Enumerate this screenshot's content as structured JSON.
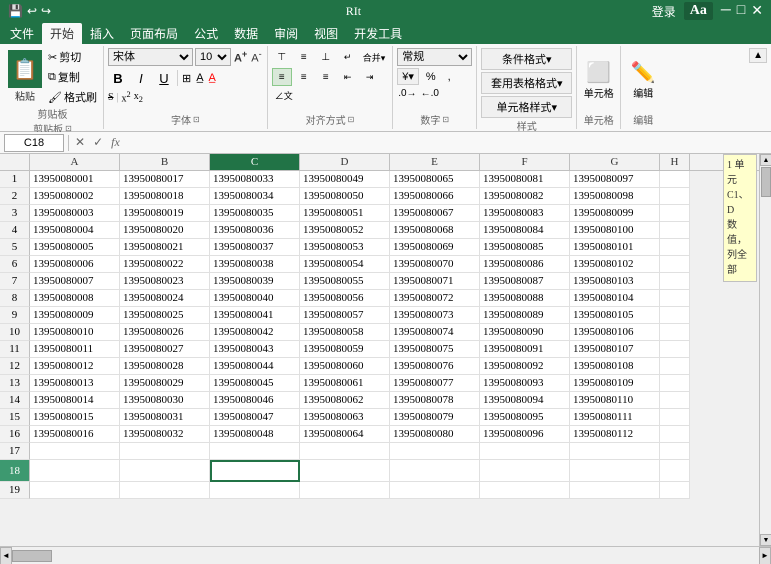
{
  "titlebar": {
    "title": "RIt",
    "login": "登录"
  },
  "ribbon": {
    "tabs": [
      "文件",
      "开始",
      "插入",
      "页面布局",
      "公式",
      "数据",
      "审阅",
      "视图",
      "开发工具"
    ],
    "active_tab": "开始",
    "aa_label": "Aa",
    "clipboard_label": "剪贴板",
    "font_label": "字体",
    "alignment_label": "对齐方式",
    "number_label": "数字",
    "styles_label": "样式",
    "cells_label": "单元格",
    "edit_label": "编辑",
    "font_name": "宋体",
    "font_size": "10",
    "paste_label": "粘贴",
    "cut_label": "剪切",
    "copy_label": "复制",
    "format_painter_label": "格式刷",
    "bold_label": "B",
    "italic_label": "I",
    "underline_label": "U",
    "strikethrough_label": "S",
    "font_grow_label": "A",
    "font_shrink_label": "A",
    "conditional_format_label": "条件格式▾",
    "format_table_label": "套用表格格式▾",
    "cell_styles_label": "单元格样式▾",
    "cells_btn_label": "单元格",
    "edit_btn_label": "编辑",
    "number_format": "常规",
    "percent_label": "%",
    "comma_label": ",",
    "increase_decimal": ".0",
    "decrease_decimal": ".00"
  },
  "formulabar": {
    "name_box": "C18",
    "cancel_label": "✕",
    "confirm_label": "✓",
    "fx_label": "fx",
    "formula_value": ""
  },
  "columns": [
    "A",
    "B",
    "C",
    "D",
    "E",
    "F",
    "G",
    "H"
  ],
  "rows": [
    {
      "row": 1,
      "cells": [
        "13950080001",
        "13950080017",
        "13950080033",
        "13950080049",
        "13950080065",
        "13950080081",
        "13950080097",
        ""
      ]
    },
    {
      "row": 2,
      "cells": [
        "13950080002",
        "13950080018",
        "13950080034",
        "13950080050",
        "13950080066",
        "13950080082",
        "13950080098",
        ""
      ]
    },
    {
      "row": 3,
      "cells": [
        "13950080003",
        "13950080019",
        "13950080035",
        "13950080051",
        "13950080067",
        "13950080083",
        "13950080099",
        ""
      ]
    },
    {
      "row": 4,
      "cells": [
        "13950080004",
        "13950080020",
        "13950080036",
        "13950080052",
        "13950080068",
        "13950080084",
        "13950080100",
        ""
      ]
    },
    {
      "row": 5,
      "cells": [
        "13950080005",
        "13950080021",
        "13950080037",
        "13950080053",
        "13950080069",
        "13950080085",
        "13950080101",
        ""
      ]
    },
    {
      "row": 6,
      "cells": [
        "13950080006",
        "13950080022",
        "13950080038",
        "13950080054",
        "13950080070",
        "13950080086",
        "13950080102",
        ""
      ]
    },
    {
      "row": 7,
      "cells": [
        "13950080007",
        "13950080023",
        "13950080039",
        "13950080055",
        "13950080071",
        "13950080087",
        "13950080103",
        ""
      ]
    },
    {
      "row": 8,
      "cells": [
        "13950080008",
        "13950080024",
        "13950080040",
        "13950080056",
        "13950080072",
        "13950080088",
        "13950080104",
        ""
      ]
    },
    {
      "row": 9,
      "cells": [
        "13950080009",
        "13950080025",
        "13950080041",
        "13950080057",
        "13950080073",
        "13950080089",
        "13950080105",
        ""
      ]
    },
    {
      "row": 10,
      "cells": [
        "13950080010",
        "13950080026",
        "13950080042",
        "13950080058",
        "13950080074",
        "13950080090",
        "13950080106",
        ""
      ]
    },
    {
      "row": 11,
      "cells": [
        "13950080011",
        "13950080027",
        "13950080043",
        "13950080059",
        "13950080075",
        "13950080091",
        "13950080107",
        ""
      ]
    },
    {
      "row": 12,
      "cells": [
        "13950080012",
        "13950080028",
        "13950080044",
        "13950080060",
        "13950080076",
        "13950080092",
        "13950080108",
        ""
      ]
    },
    {
      "row": 13,
      "cells": [
        "13950080013",
        "13950080029",
        "13950080045",
        "13950080061",
        "13950080077",
        "13950080093",
        "13950080109",
        ""
      ]
    },
    {
      "row": 14,
      "cells": [
        "13950080014",
        "13950080030",
        "13950080046",
        "13950080062",
        "13950080078",
        "13950080094",
        "13950080110",
        ""
      ]
    },
    {
      "row": 15,
      "cells": [
        "13950080015",
        "13950080031",
        "13950080047",
        "13950080063",
        "13950080079",
        "13950080095",
        "13950080111",
        ""
      ]
    },
    {
      "row": 16,
      "cells": [
        "13950080016",
        "13950080032",
        "13950080048",
        "13950080064",
        "13950080080",
        "13950080096",
        "13950080112",
        ""
      ]
    },
    {
      "row": 17,
      "cells": [
        "",
        "",
        "",
        "",
        "",
        "",
        "",
        ""
      ]
    },
    {
      "row": 18,
      "cells": [
        "",
        "",
        "",
        "",
        "",
        "",
        "",
        ""
      ]
    },
    {
      "row": 19,
      "cells": [
        "",
        "",
        "",
        "",
        "",
        "",
        "",
        ""
      ]
    }
  ],
  "active_cell": {
    "row": 18,
    "col": 2
  },
  "tooltip": {
    "line1": "1 单元",
    "line2": "C1、D",
    "line3": "数值，",
    "line4": "列全部"
  },
  "colors": {
    "excel_green": "#217346",
    "selected_cell_border": "#217346",
    "header_bg": "#f2f2f2",
    "grid_line": "#e0e0e0"
  }
}
